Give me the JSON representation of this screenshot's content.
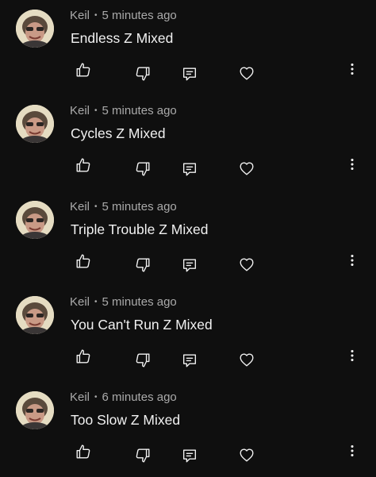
{
  "comments": [
    {
      "author": "Keil",
      "time": "5 minutes ago",
      "text": "Endless Z Mixed"
    },
    {
      "author": "Keil",
      "time": "5 minutes ago",
      "text": "Cycles Z Mixed"
    },
    {
      "author": "Keil",
      "time": "5 minutes ago",
      "text": "Triple Trouble Z Mixed"
    },
    {
      "author": "Keil",
      "time": "5 minutes ago",
      "text": "You Can't Run Z Mixed"
    },
    {
      "author": "Keil",
      "time": "6 minutes ago",
      "text": "Too Slow Z Mixed"
    }
  ],
  "separator": "•",
  "colors": {
    "background": "#0f0f0f",
    "primary_text": "#f1f1f1",
    "secondary_text": "#aaaaaa"
  },
  "icons": [
    "thumbs-up-icon",
    "thumbs-down-icon",
    "reply-icon",
    "heart-icon",
    "more-vert-icon"
  ]
}
